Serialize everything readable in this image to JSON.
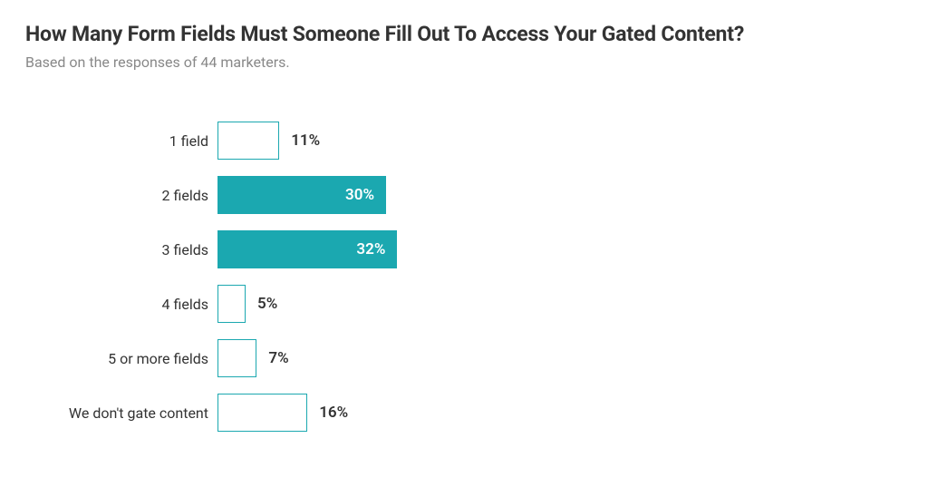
{
  "title": "How Many Form Fields Must Someone Fill Out To Access Your Gated Content?",
  "subtitle": "Based on the responses of 44 marketers.",
  "chart_data": {
    "type": "bar",
    "orientation": "horizontal",
    "categories": [
      "1 field",
      "2 fields",
      "3 fields",
      "4 fields",
      "5 or more fields",
      "We don't gate content"
    ],
    "values": [
      11,
      30,
      32,
      5,
      7,
      16
    ],
    "value_suffix": "%",
    "xlim": [
      0,
      100
    ],
    "highlighted_indices": [
      1,
      2
    ],
    "colors": {
      "filled": "#1ba8b0",
      "outline": "#1ba8b0"
    }
  },
  "bars": [
    {
      "label": "1 field",
      "value_text": "11%",
      "pct": 11,
      "filled": false,
      "inside": false
    },
    {
      "label": "2 fields",
      "value_text": "30%",
      "pct": 30,
      "filled": true,
      "inside": true
    },
    {
      "label": "3 fields",
      "value_text": "32%",
      "pct": 32,
      "filled": true,
      "inside": true
    },
    {
      "label": "4 fields",
      "value_text": "5%",
      "pct": 5,
      "filled": false,
      "inside": false
    },
    {
      "label": "5 or more fields",
      "value_text": "7%",
      "pct": 7,
      "filled": false,
      "inside": false
    },
    {
      "label": "We don't gate content",
      "value_text": "16%",
      "pct": 16,
      "filled": false,
      "inside": false
    }
  ]
}
